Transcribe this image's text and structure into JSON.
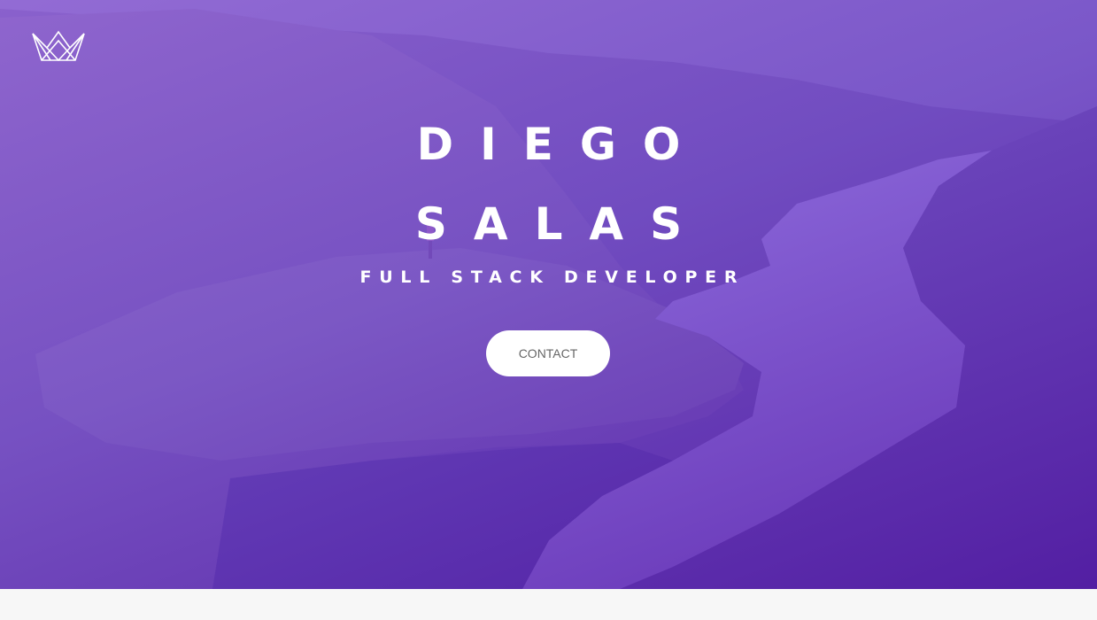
{
  "header": {
    "logo_icon": "crown-icon"
  },
  "hero": {
    "name_first": "DIEGO",
    "name_last": "SALAS",
    "subtitle": "FULL STACK DEVELOPER",
    "contact_label": "CONTACT"
  },
  "colors": {
    "overlay_top": "#9664e6",
    "overlay_bottom": "#5014aa",
    "button_bg": "#ffffff",
    "button_text": "#666666",
    "page_bg": "#f7f7f7"
  }
}
